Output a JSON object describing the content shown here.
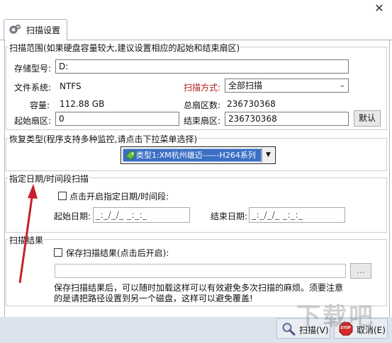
{
  "window": {
    "close_glyph": "✕"
  },
  "tab": {
    "label": "扫描设置",
    "icon": "gear-icon"
  },
  "scan_range": {
    "title": "扫描范围(如果硬盘容量较大,建议设置相应的起始和结束扇区)",
    "device_label": "存储型号:",
    "device_value": "D:",
    "fs_label": "文件系统:",
    "fs_value": "NTFS",
    "method_label": "扫描方式:",
    "method_value": "全部扫描",
    "capacity_label": "容量:",
    "capacity_value": "112.88 GB",
    "total_label": "总扇区数:",
    "total_value": "236730368",
    "start_label": "起始扇区:",
    "start_value": "0",
    "end_label": "结束扇区:",
    "end_value": "236730368",
    "default_button": "默认"
  },
  "recovery_type": {
    "title": "恢复类型(程序支持多种监控,请点击下拉菜单选择)",
    "selected": "类型1:XM杭州雄迈------H264系列"
  },
  "time_scan": {
    "title": "指定日期/时间段扫描",
    "checkbox_label": "点击开启指定日期/时间段:",
    "start_label": "起始日期:",
    "start_mask": "_:_/_/_ _:_:_",
    "end_label": "结束日期:",
    "end_mask": "_:_/_/_ _:_:_"
  },
  "scan_result": {
    "title": "扫描结果",
    "checkbox_label": "保存扫描结果(点击后开启):",
    "path_value": "",
    "browse_label": "...",
    "note_line1": "保存扫描结果后，可以随时加载这样可以有效避免多次扫描的麻烦。须要注意",
    "note_line2": "的是请把路径设置到另一个磁盘，这样可以避免覆盖!"
  },
  "footer": {
    "scan_button": "扫描(V)",
    "cancel_button": "取消(E)",
    "stop_icon_text": "STOP",
    "watermark": "下载吧"
  },
  "colors": {
    "accent_red": "#b41e1e",
    "selection_blue": "#3a6fc4",
    "annotation_arrow": "#c8202a"
  }
}
